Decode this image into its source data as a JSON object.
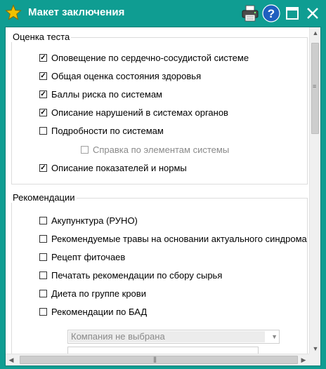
{
  "window": {
    "title": "Макет заключения"
  },
  "icons": {
    "star": "star-icon",
    "print": "printer-icon",
    "help": "help-icon",
    "maximize": "maximize-icon",
    "close": "close-icon"
  },
  "section_test": {
    "title": "Оценка теста",
    "items": [
      {
        "label": "Оповещение по сердечно-сосудистой системе",
        "checked": true
      },
      {
        "label": "Общая оценка состояния здоровья",
        "checked": true
      },
      {
        "label": "Баллы риска по системам",
        "checked": true
      },
      {
        "label": "Описание нарушений в системах органов",
        "checked": true
      },
      {
        "label": "Подробности по системам",
        "checked": false
      },
      {
        "label": "Справка по элементам системы",
        "checked": false,
        "disabled": true
      },
      {
        "label": "Описание показателей и нормы",
        "checked": true
      }
    ]
  },
  "section_reco": {
    "title": "Рекомендации",
    "items": [
      {
        "label": "Акупунктура (РУНО)",
        "checked": false
      },
      {
        "label": "Рекомендуемые травы на основании актуального синдрома",
        "checked": false
      },
      {
        "label": "Рецепт фиточаев",
        "checked": false
      },
      {
        "label": "Печатать рекомендации по сбору сырья",
        "checked": false
      },
      {
        "label": "Диета по группе крови",
        "checked": false
      },
      {
        "label": "Рекомендации по БАД",
        "checked": false
      }
    ],
    "company_select": {
      "value": "Компания не выбрана"
    }
  },
  "colors": {
    "titlebar": "#0f9d92",
    "help_blue": "#1f5fbf",
    "star_yellow": "#f2c200"
  }
}
